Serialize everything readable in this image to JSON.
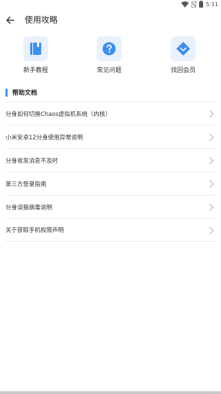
{
  "status_bar": {
    "time": "5:11"
  },
  "appbar": {
    "title": "使用攻略"
  },
  "shortcuts": [
    {
      "label": "新手教程",
      "icon": "book-icon"
    },
    {
      "label": "常见问题",
      "icon": "question-icon"
    },
    {
      "label": "找回会员",
      "icon": "diamond-icon"
    }
  ],
  "section": {
    "title": "帮助文档"
  },
  "docs": [
    {
      "title": "分身如何切换Chaos虚拟机系统（内核）"
    },
    {
      "title": "小米安卓12分身使用异常说明"
    },
    {
      "title": "分身收发消息不及时"
    },
    {
      "title": "第三方登录指南"
    },
    {
      "title": "分身误报病毒说明"
    },
    {
      "title": "关于获取手机权限声明"
    }
  ],
  "colors": {
    "accent": "#3d8ef0",
    "tile_bg": "#e8f1fc"
  }
}
